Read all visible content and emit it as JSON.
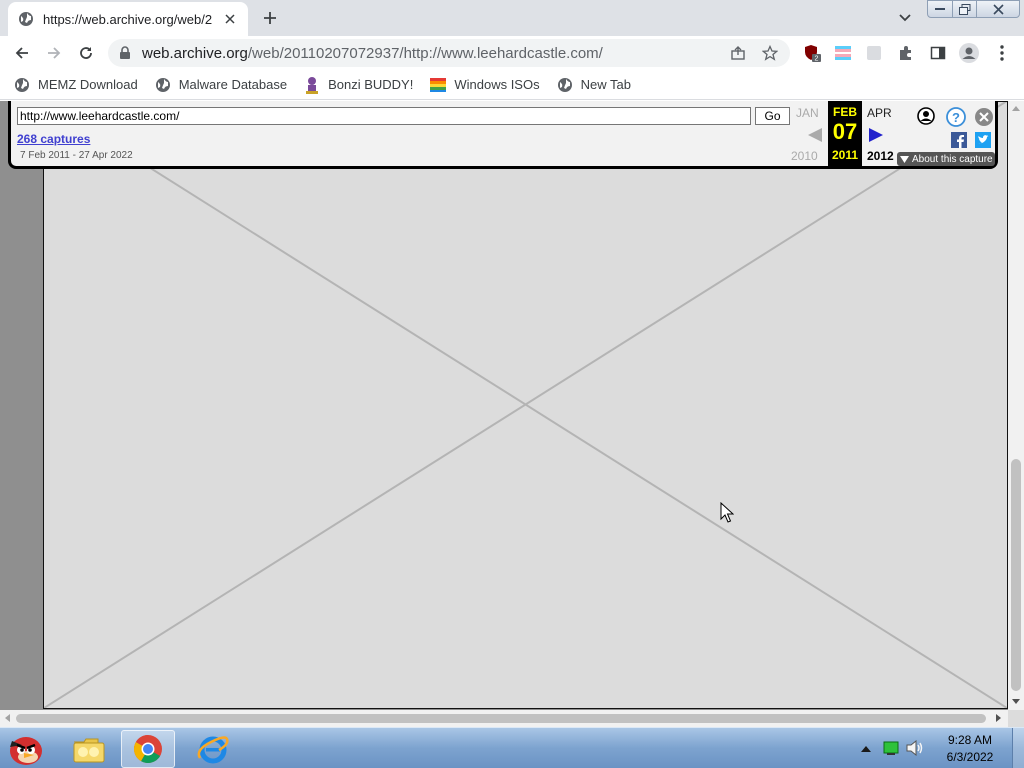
{
  "browser": {
    "tab": {
      "title": "https://web.archive.org/web/2"
    },
    "address": {
      "host": "web.archive.org",
      "path": "/web/20110207072937/http://www.leehardcastle.com/"
    },
    "extension_badge": "2"
  },
  "bookmarks": [
    {
      "label": "MEMZ Download",
      "icon": "globe-icon"
    },
    {
      "label": "Malware Database",
      "icon": "globe-icon"
    },
    {
      "label": "Bonzi BUDDY!",
      "icon": "bonzi-icon"
    },
    {
      "label": "Windows ISOs",
      "icon": "windows-icon"
    },
    {
      "label": "New Tab",
      "icon": "globe-icon"
    }
  ],
  "wayback": {
    "url_value": "http://www.leehardcastle.com/",
    "go_label": "Go",
    "captures_label": "268 captures",
    "date_range": "7 Feb 2011 - 27 Apr 2022",
    "prev_month": "JAN",
    "current_month": "FEB",
    "next_month": "APR",
    "current_day": "07",
    "prev_year": "2010",
    "current_year": "2011",
    "next_year": "2012",
    "about_label": "About this capture"
  },
  "taskbar": {
    "time": "9:28 AM",
    "date": "6/3/2022"
  },
  "colors": {
    "wayback_highlight": "#ffff00",
    "omnibox_bg": "#f1f3f4",
    "taskbar": "#7da3cf"
  }
}
